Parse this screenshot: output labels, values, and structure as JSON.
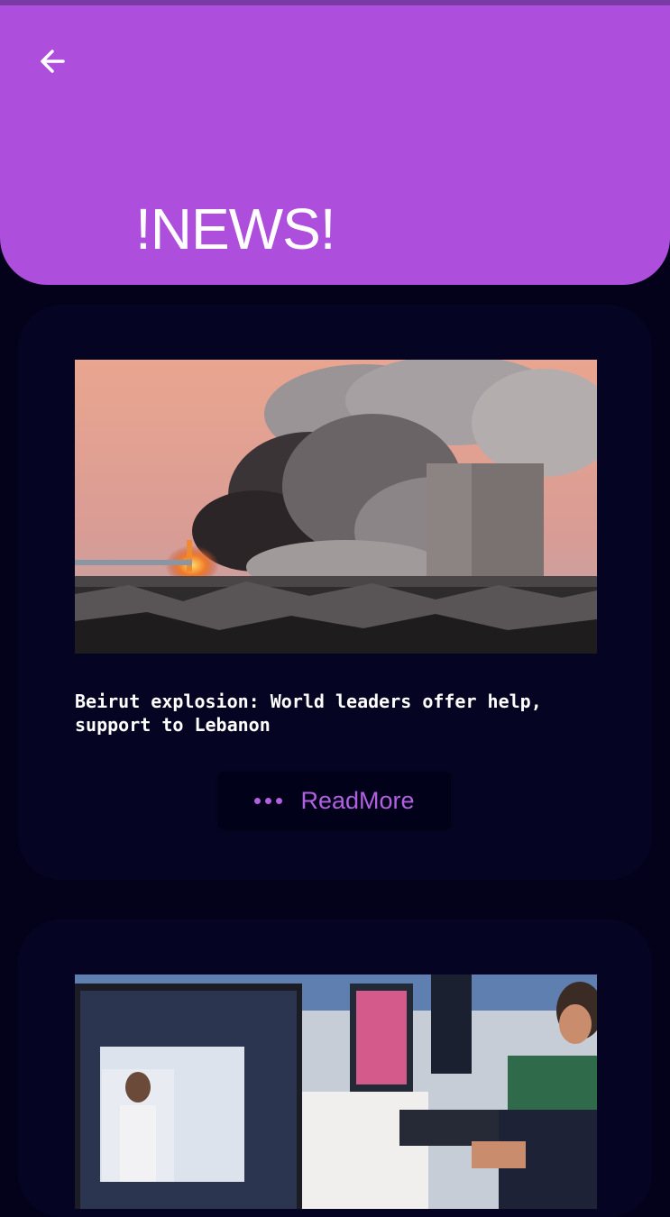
{
  "header": {
    "title": "!NEWS!",
    "back_icon": "arrow-left-icon",
    "color": "#ad4fdc"
  },
  "articles": [
    {
      "headline": "Beirut explosion: World leaders offer help, support to Lebanon",
      "image": "port explosion smoke photo",
      "action_label": "ReadMore",
      "action_icon": "more-dots-icon"
    },
    {
      "image": "office workers at computers photo"
    }
  ],
  "colors": {
    "background": "#03021a",
    "card": "#050523",
    "accent": "#b061e0"
  }
}
